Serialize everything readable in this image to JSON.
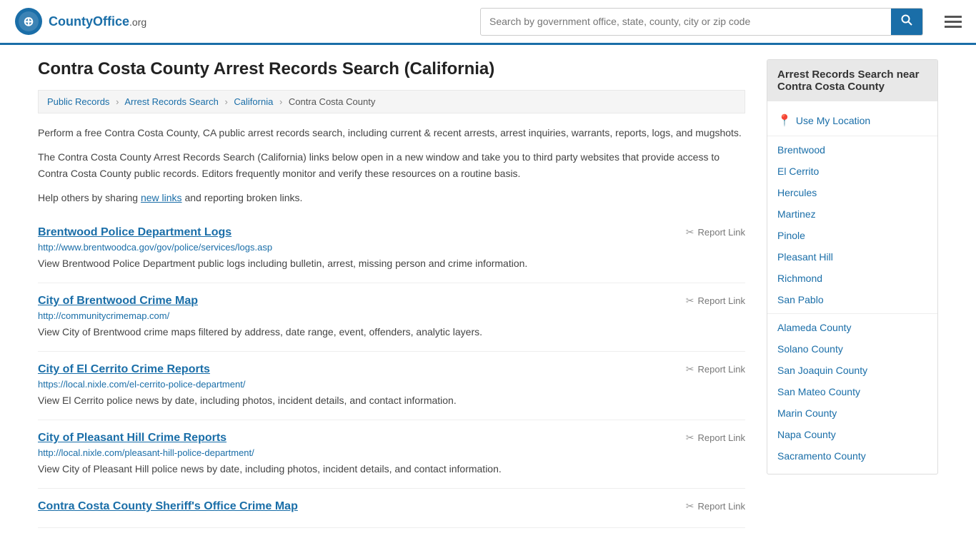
{
  "header": {
    "logo_text": "CountyOffice",
    "logo_org": ".org",
    "search_placeholder": "Search by government office, state, county, city or zip code",
    "search_value": ""
  },
  "page": {
    "title": "Contra Costa County Arrest Records Search (California)"
  },
  "breadcrumb": {
    "items": [
      {
        "label": "Public Records",
        "href": "#"
      },
      {
        "label": "Arrest Records Search",
        "href": "#"
      },
      {
        "label": "California",
        "href": "#"
      },
      {
        "label": "Contra Costa County",
        "href": "#"
      }
    ]
  },
  "description": {
    "para1": "Perform a free Contra Costa County, CA public arrest records search, including current & recent arrests, arrest inquiries, warrants, reports, logs, and mugshots.",
    "para2": "The Contra Costa County Arrest Records Search (California) links below open in a new window and take you to third party websites that provide access to Contra Costa County public records. Editors frequently monitor and verify these resources on a routine basis.",
    "para3_before": "Help others by sharing ",
    "para3_link": "new links",
    "para3_after": " and reporting broken links."
  },
  "results": [
    {
      "id": "r1",
      "title": "Brentwood Police Department Logs",
      "url": "http://www.brentwoodca.gov/gov/police/services/logs.asp",
      "desc": "View Brentwood Police Department public logs including bulletin, arrest, missing person and crime information."
    },
    {
      "id": "r2",
      "title": "City of Brentwood Crime Map",
      "url": "http://communitycrimemap.com/",
      "desc": "View City of Brentwood crime maps filtered by address, date range, event, offenders, analytic layers."
    },
    {
      "id": "r3",
      "title": "City of El Cerrito Crime Reports",
      "url": "https://local.nixle.com/el-cerrito-police-department/",
      "desc": "View El Cerrito police news by date, including photos, incident details, and contact information."
    },
    {
      "id": "r4",
      "title": "City of Pleasant Hill Crime Reports",
      "url": "http://local.nixle.com/pleasant-hill-police-department/",
      "desc": "View City of Pleasant Hill police news by date, including photos, incident details, and contact information."
    },
    {
      "id": "r5",
      "title": "Contra Costa County Sheriff's Office Crime Map",
      "url": "",
      "desc": ""
    }
  ],
  "report_link_label": "Report Link",
  "sidebar": {
    "header": "Arrest Records Search near Contra Costa County",
    "use_my_location": "Use My Location",
    "cities": [
      {
        "label": "Brentwood"
      },
      {
        "label": "El Cerrito"
      },
      {
        "label": "Hercules"
      },
      {
        "label": "Martinez"
      },
      {
        "label": "Pinole"
      },
      {
        "label": "Pleasant Hill"
      },
      {
        "label": "Richmond"
      },
      {
        "label": "San Pablo"
      }
    ],
    "nearby_counties": [
      {
        "label": "Alameda County"
      },
      {
        "label": "Solano County"
      },
      {
        "label": "San Joaquin County"
      },
      {
        "label": "San Mateo County"
      },
      {
        "label": "Marin County"
      },
      {
        "label": "Napa County"
      },
      {
        "label": "Sacramento County"
      }
    ]
  }
}
